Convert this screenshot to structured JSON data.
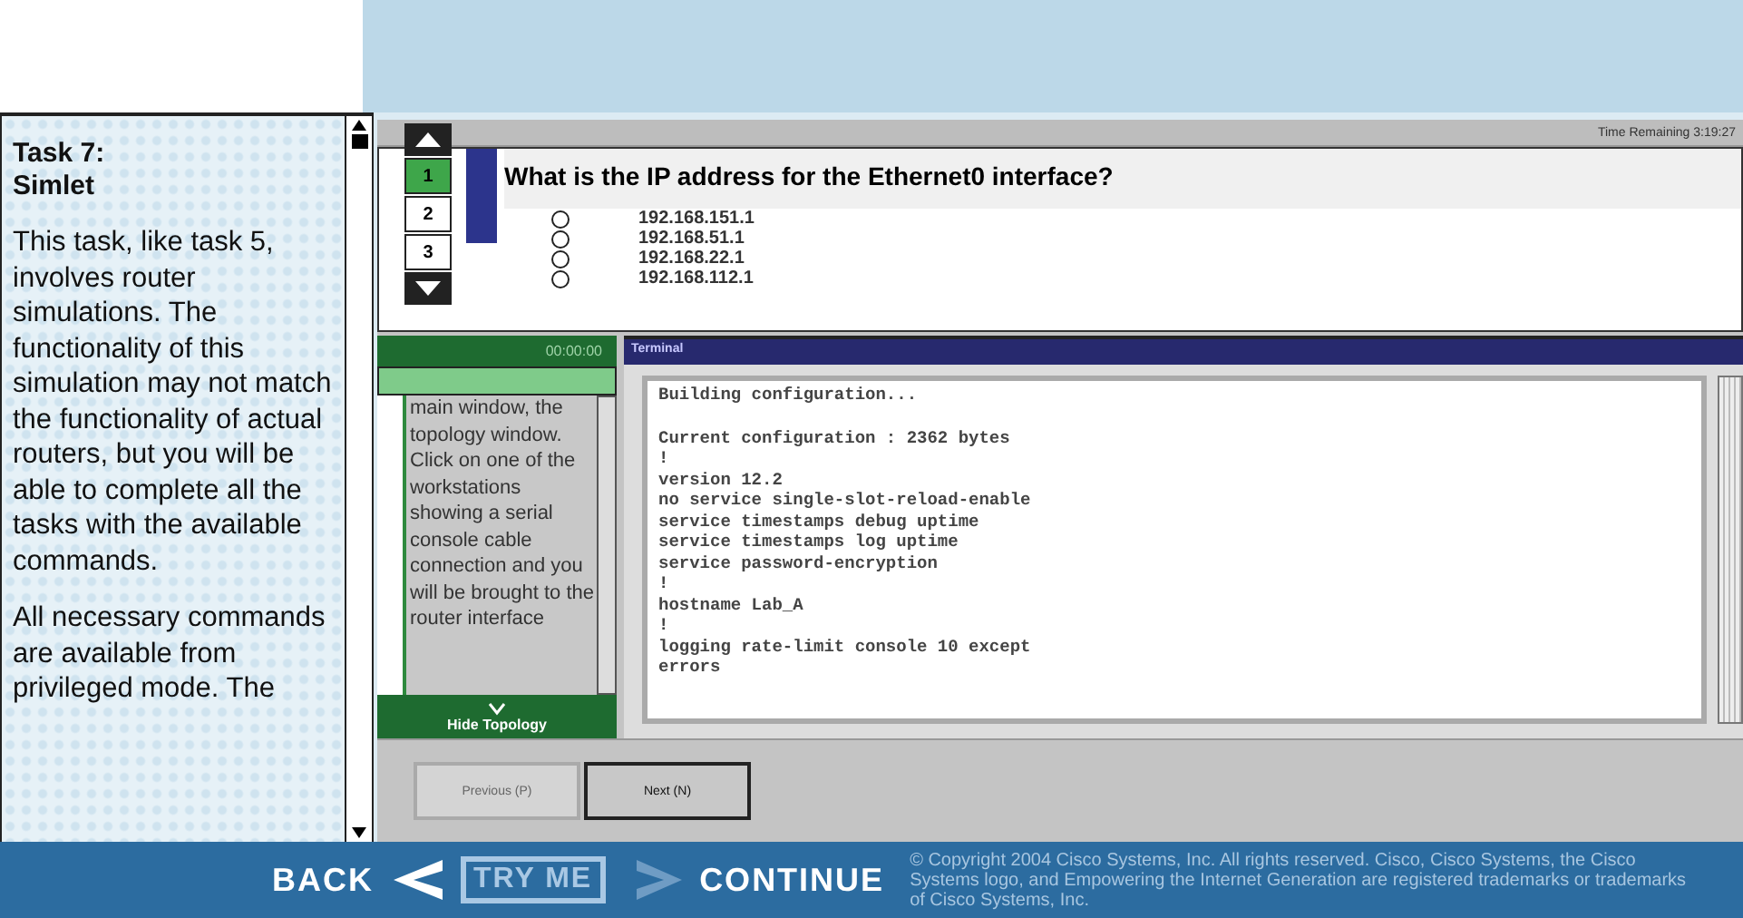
{
  "task_panel": {
    "title": "Task 7:",
    "subtitle": "Simlet",
    "paragraphs": [
      "This task, like task 5, involves router simulations. The functionality of this simulation may not match the functionality of actual routers, but you will be able to complete all the tasks with the available commands.",
      "All necessary commands are available from privileged mode. The"
    ]
  },
  "exam": {
    "time_remaining": "Time Remaining 3:19:27",
    "questions": [
      {
        "label": "1",
        "selected": true
      },
      {
        "label": "2",
        "selected": false
      },
      {
        "label": "3",
        "selected": false
      }
    ],
    "question": "What is the IP address for the Ethernet0 interface?",
    "options": [
      {
        "label": "192.168.151.1",
        "selected": false
      },
      {
        "label": "192.168.51.1",
        "selected": false
      },
      {
        "label": "192.168.22.1",
        "selected": false
      },
      {
        "label": "192.168.112.1",
        "selected": false
      }
    ],
    "topology": {
      "timer": "00:00:00",
      "text": "main window, the topology window. Click on one of the workstations showing a serial console cable connection and you will be brought to the router interface",
      "toggle": "Hide Topology"
    },
    "terminal": {
      "title": "Terminal",
      "lines": [
        "Building configuration...",
        "Current configuration : 2362 bytes",
        "!",
        "version 12.2",
        "no service single-slot-reload-enable",
        "service timestamps debug uptime",
        "service timestamps log uptime",
        "service password-encryption",
        "!",
        "hostname Lab_A",
        "!",
        "logging rate-limit console 10 except",
        "errors"
      ]
    },
    "buttons": [
      {
        "label": "Previous (P)",
        "disabled": true
      },
      {
        "label": "Next (N)",
        "disabled": false
      }
    ]
  },
  "footer": {
    "back": "BACK",
    "try_me": "TRY ME",
    "continue": "CONTINUE",
    "copyright": "© Copyright 2004 Cisco Systems, Inc. All rights reserved. Cisco, Cisco Systems, the Cisco Systems logo, and Empowering the Internet Generation are registered trademarks or trademarks of Cisco Systems, Inc."
  }
}
